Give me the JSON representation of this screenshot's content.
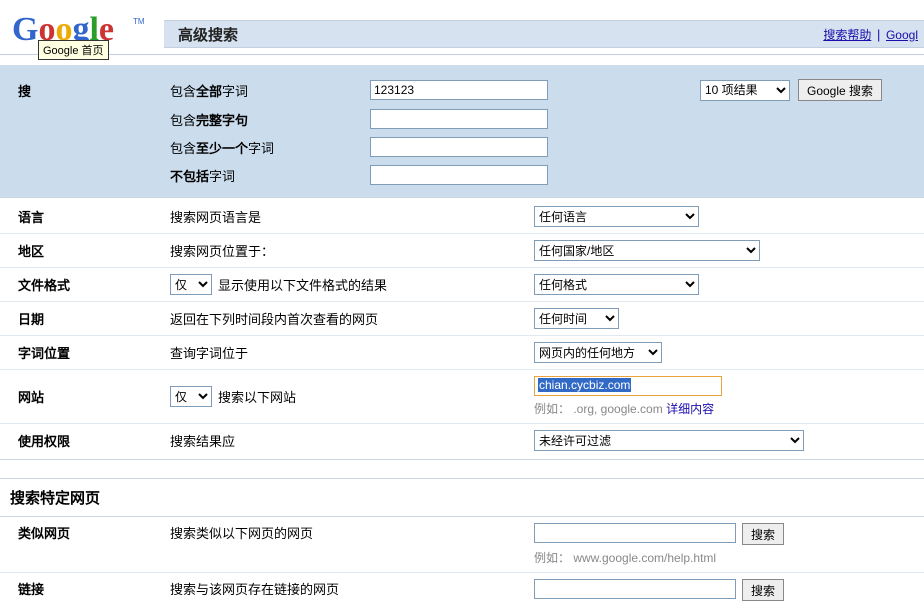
{
  "header": {
    "title": "高级搜索",
    "help_link": "搜索帮助",
    "google_link": "Googl",
    "tooltip": "Google 首页"
  },
  "blue": {
    "side_label_partial": "搜",
    "all_words": {
      "label_pre": "包含",
      "label_bold": "全部",
      "label_post": "字词",
      "value": "123123"
    },
    "exact": {
      "label_pre": "包含",
      "label_bold": "完整字句",
      "label_post": "",
      "value": ""
    },
    "any": {
      "label_pre": "包含",
      "label_bold": "至少一个",
      "label_post": "字词",
      "value": ""
    },
    "none": {
      "label_pre": "",
      "label_bold": "不包括",
      "label_post": "字词",
      "value": ""
    },
    "results_sel": "10 项结果",
    "search_btn": "Google 搜索"
  },
  "opts": {
    "lang": {
      "label": "语言",
      "desc": "搜索网页语言是",
      "sel": "任何语言"
    },
    "region": {
      "label": "地区",
      "desc": "搜索网页位置于：",
      "sel": "任何国家/地区"
    },
    "fmt": {
      "label": "文件格式",
      "only_label": "仅",
      "desc": "显示使用以下文件格式的结果",
      "sel": "任何格式"
    },
    "date": {
      "label": "日期",
      "desc": "返回在下列时间段内首次查看的网页",
      "sel": "任何时间"
    },
    "where": {
      "label": "字词位置",
      "desc": "查询字词位于",
      "sel": "网页内的任何地方"
    },
    "site": {
      "label": "网站",
      "only_label": "仅",
      "desc": "搜索以下网站",
      "value": "chian.cycbiz.com",
      "hint_pre": "例如：   .org, google.com   ",
      "hint_link": "详细内容"
    },
    "usage": {
      "label": "使用权限",
      "desc": "搜索结果应",
      "sel": "未经许可过滤"
    }
  },
  "section2": {
    "title": "搜索特定网页",
    "similar": {
      "label": "类似网页",
      "desc": "搜索类似以下网页的网页",
      "btn": "搜索",
      "hint": "例如：   www.google.com/help.html"
    },
    "links": {
      "label": "链接",
      "desc": "搜索与该网页存在链接的网页",
      "btn": "搜索"
    }
  }
}
